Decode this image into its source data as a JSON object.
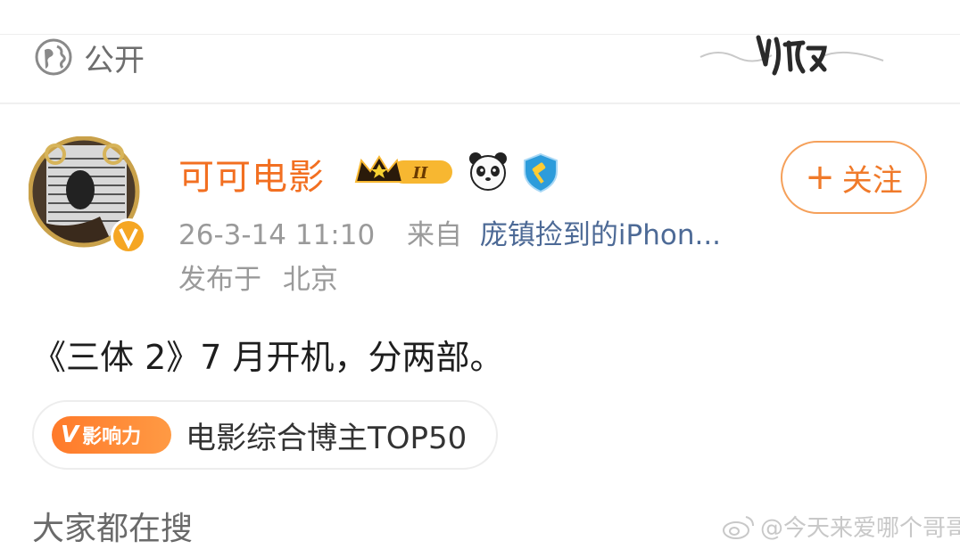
{
  "header": {
    "privacy_label": "公开"
  },
  "post": {
    "author": {
      "name": "可可电影",
      "level_badge": "II"
    },
    "follow_button": {
      "plus": "+",
      "label": "关注"
    },
    "meta": {
      "time": "26-3-14 11:10",
      "from_label": "来自",
      "device": "庞镇捡到的iPhon..."
    },
    "location": {
      "prefix": "发布于",
      "place": "北京"
    },
    "content": "《三体 2》7 月开机，分两部。",
    "tag": {
      "badge_text": "影响力",
      "badge_v": "V",
      "label": "电影综合博主TOP50"
    }
  },
  "section": {
    "title": "大家都在搜"
  },
  "watermark": {
    "text": "@今天来爱哪个哥哥"
  },
  "colors": {
    "accent": "#f26f21",
    "link": "#4d6a96",
    "muted": "#9a9a9a"
  }
}
